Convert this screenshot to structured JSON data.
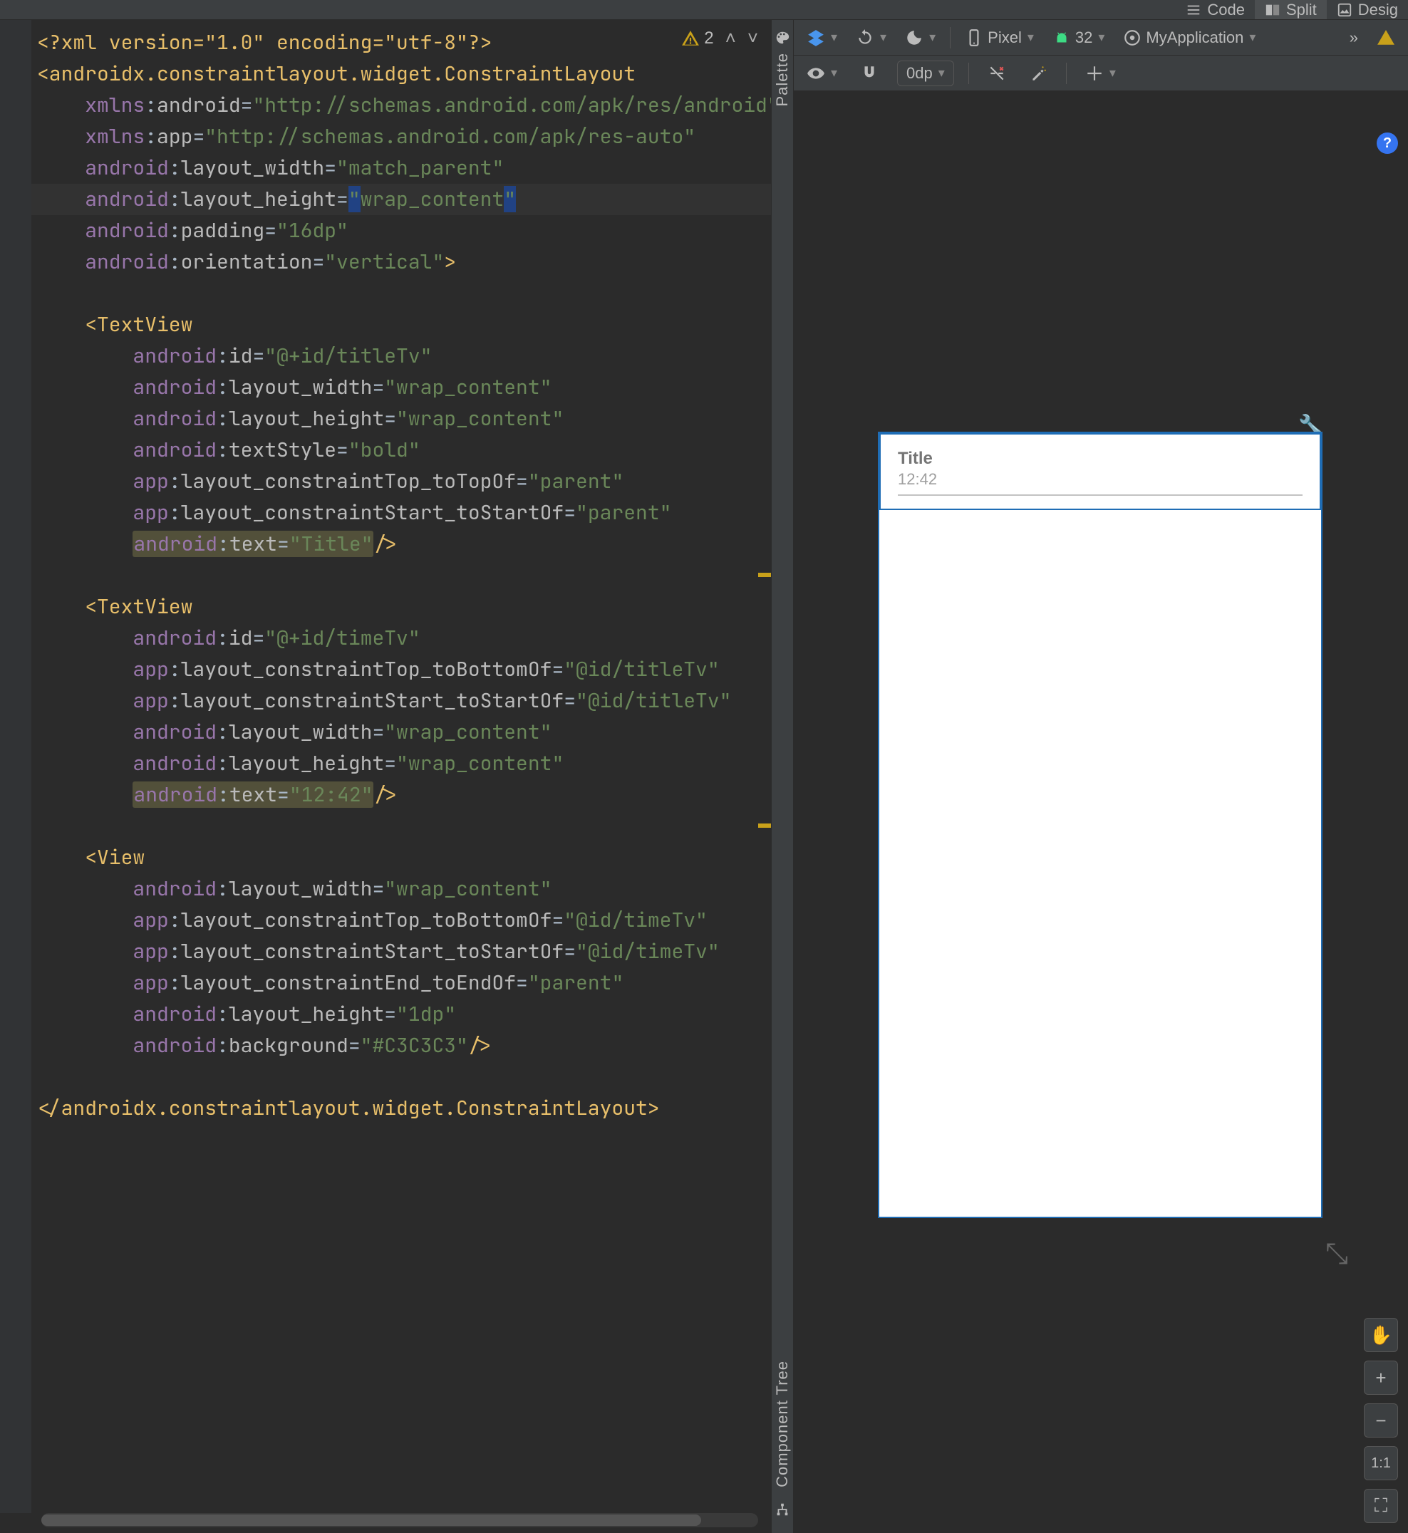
{
  "topbar": {
    "code": "Code",
    "split": "Split",
    "design": "Desig"
  },
  "editor": {
    "warning_count": "2",
    "yellow_marker_lines": [
      18,
      26
    ],
    "code_lines": [
      {
        "type": "proc",
        "raw": "<?xml version=\"1.0\" encoding=\"utf-8\"?>"
      },
      {
        "type": "open",
        "indent": 0,
        "tag": "androidx.constraintlayout.widget.ConstraintLayout"
      },
      {
        "type": "attr",
        "indent": 2,
        "ns": "xmlns",
        "name": "android",
        "value": "http://schemas.android.com/apk/res/android"
      },
      {
        "type": "attr",
        "indent": 2,
        "ns": "xmlns",
        "name": "app",
        "value": "http://schemas.android.com/apk/res-auto"
      },
      {
        "type": "attr",
        "indent": 2,
        "ns": "android",
        "name": "layout_width",
        "value": "match_parent"
      },
      {
        "type": "attr",
        "indent": 2,
        "ns": "android",
        "name": "layout_height",
        "value": "wrap_content",
        "cursor": true,
        "line_highlight": true
      },
      {
        "type": "attr",
        "indent": 2,
        "ns": "android",
        "name": "padding",
        "value": "16dp"
      },
      {
        "type": "attr_close",
        "indent": 2,
        "ns": "android",
        "name": "orientation",
        "value": "vertical"
      },
      {
        "type": "blank"
      },
      {
        "type": "open",
        "indent": 2,
        "tag": "TextView"
      },
      {
        "type": "attr",
        "indent": 4,
        "ns": "android",
        "name": "id",
        "value": "@+id/titleTv"
      },
      {
        "type": "attr",
        "indent": 4,
        "ns": "android",
        "name": "layout_width",
        "value": "wrap_content"
      },
      {
        "type": "attr",
        "indent": 4,
        "ns": "android",
        "name": "layout_height",
        "value": "wrap_content"
      },
      {
        "type": "attr",
        "indent": 4,
        "ns": "android",
        "name": "textStyle",
        "value": "bold"
      },
      {
        "type": "attr",
        "indent": 4,
        "ns": "app",
        "name": "layout_constraintTop_toTopOf",
        "value": "parent"
      },
      {
        "type": "attr",
        "indent": 4,
        "ns": "app",
        "name": "layout_constraintStart_toStartOf",
        "value": "parent"
      },
      {
        "type": "attr_selfclose",
        "indent": 4,
        "ns": "android",
        "name": "text",
        "value": "Title",
        "hl": true
      },
      {
        "type": "blank"
      },
      {
        "type": "open",
        "indent": 2,
        "tag": "TextView"
      },
      {
        "type": "attr",
        "indent": 4,
        "ns": "android",
        "name": "id",
        "value": "@+id/timeTv"
      },
      {
        "type": "attr",
        "indent": 4,
        "ns": "app",
        "name": "layout_constraintTop_toBottomOf",
        "value": "@id/titleTv"
      },
      {
        "type": "attr",
        "indent": 4,
        "ns": "app",
        "name": "layout_constraintStart_toStartOf",
        "value": "@id/titleTv"
      },
      {
        "type": "attr",
        "indent": 4,
        "ns": "android",
        "name": "layout_width",
        "value": "wrap_content"
      },
      {
        "type": "attr",
        "indent": 4,
        "ns": "android",
        "name": "layout_height",
        "value": "wrap_content"
      },
      {
        "type": "attr_selfclose",
        "indent": 4,
        "ns": "android",
        "name": "text",
        "value": "12:42",
        "hl": true
      },
      {
        "type": "blank"
      },
      {
        "type": "open",
        "indent": 2,
        "tag": "View"
      },
      {
        "type": "attr",
        "indent": 4,
        "ns": "android",
        "name": "layout_width",
        "value": "wrap_content"
      },
      {
        "type": "attr",
        "indent": 4,
        "ns": "app",
        "name": "layout_constraintTop_toBottomOf",
        "value": "@id/timeTv"
      },
      {
        "type": "attr",
        "indent": 4,
        "ns": "app",
        "name": "layout_constraintStart_toStartOf",
        "value": "@id/timeTv"
      },
      {
        "type": "attr",
        "indent": 4,
        "ns": "app",
        "name": "layout_constraintEnd_toEndOf",
        "value": "parent"
      },
      {
        "type": "attr",
        "indent": 4,
        "ns": "android",
        "name": "layout_height",
        "value": "1dp"
      },
      {
        "type": "attr_selfclose",
        "indent": 4,
        "ns": "android",
        "name": "background",
        "value": "#C3C3C3"
      },
      {
        "type": "blank"
      },
      {
        "type": "close",
        "indent": 0,
        "tag": "androidx.constraintlayout.widget.ConstraintLayout"
      }
    ],
    "fold_markers": {
      "1": "⊖",
      "9": "⊖",
      "16": "⊟",
      "18": "⊖",
      "24": "⊟",
      "26": "⊖",
      "32": "⊟",
      "34": "⊟"
    }
  },
  "side_panels": {
    "palette": "Palette",
    "component_tree": "Component Tree"
  },
  "design": {
    "toolbar": {
      "device": "Pixel",
      "api": "32",
      "app": "MyApplication",
      "overflow": "»"
    },
    "toolbar2": {
      "zoom_value": "0dp"
    },
    "preview": {
      "title": "Title",
      "time": "12:42"
    },
    "zoom": {
      "pan": "✋",
      "plus": "+",
      "minus": "−",
      "one": "1:1",
      "fit": "⛶"
    },
    "help": "?"
  }
}
